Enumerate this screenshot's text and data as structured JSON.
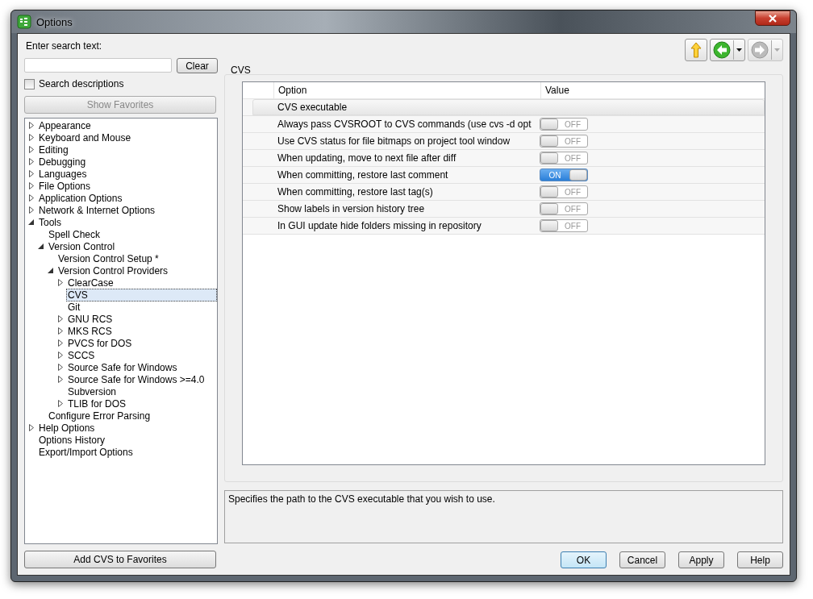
{
  "window": {
    "title": "Options"
  },
  "search": {
    "label": "Enter search text:",
    "clear_button": "Clear",
    "descriptions_checkbox": {
      "label": "Search descriptions",
      "checked": false
    },
    "favorites_button": {
      "label": "Show Favorites",
      "disabled": true
    }
  },
  "tree": {
    "items": [
      {
        "label": "Appearance",
        "expanded": false,
        "selected": false
      },
      {
        "label": "Keyboard and Mouse",
        "expanded": false,
        "selected": false
      },
      {
        "label": "Editing",
        "expanded": false,
        "selected": false
      },
      {
        "label": "Debugging",
        "expanded": false,
        "selected": false
      },
      {
        "label": "Languages",
        "expanded": false,
        "selected": false
      },
      {
        "label": "File Options",
        "expanded": false,
        "selected": false
      },
      {
        "label": "Application Options",
        "expanded": false,
        "selected": false
      },
      {
        "label": "Network & Internet Options",
        "expanded": false,
        "selected": false
      },
      {
        "label": "Tools",
        "expanded": true,
        "selected": false,
        "children": [
          {
            "label": "Spell Check",
            "selected": false
          },
          {
            "label": "Version Control",
            "expanded": true,
            "selected": false,
            "children": [
              {
                "label": "Version Control Setup *",
                "selected": false
              },
              {
                "label": "Version Control Providers",
                "expanded": true,
                "selected": false,
                "children": [
                  {
                    "label": "ClearCase",
                    "expanded": false,
                    "selected": false
                  },
                  {
                    "label": "CVS",
                    "selected": true
                  },
                  {
                    "label": "Git",
                    "selected": false
                  },
                  {
                    "label": "GNU RCS",
                    "expanded": false,
                    "selected": false
                  },
                  {
                    "label": "MKS RCS",
                    "expanded": false,
                    "selected": false
                  },
                  {
                    "label": "PVCS for DOS",
                    "expanded": false,
                    "selected": false
                  },
                  {
                    "label": "SCCS",
                    "expanded": false,
                    "selected": false
                  },
                  {
                    "label": "Source Safe for Windows",
                    "expanded": false,
                    "selected": false
                  },
                  {
                    "label": "Source Safe for Windows >=4.0",
                    "expanded": false,
                    "selected": false
                  },
                  {
                    "label": "Subversion",
                    "selected": false
                  },
                  {
                    "label": "TLIB for DOS",
                    "expanded": false,
                    "selected": false
                  }
                ]
              }
            ]
          },
          {
            "label": "Configure Error Parsing",
            "selected": false
          }
        ]
      },
      {
        "label": "Help Options",
        "expanded": false,
        "selected": false
      },
      {
        "label": "Options History",
        "selected": false
      },
      {
        "label": "Export/Import Options",
        "selected": false
      }
    ]
  },
  "add_favorites_button": "Add CVS to Favorites",
  "toolbar": {
    "up_button": {
      "disabled": false
    },
    "back_button": {
      "disabled": false
    },
    "forward_button": {
      "disabled": true
    }
  },
  "panel": {
    "title": "CVS",
    "table": {
      "columns": [
        "Option",
        "Value"
      ],
      "rows": [
        {
          "kind": "group",
          "label": "CVS executable"
        },
        {
          "kind": "toggle",
          "label": "Always pass CVSROOT to CVS commands (use cvs -d opt",
          "on": false,
          "switch_label": "OFF"
        },
        {
          "kind": "toggle",
          "label": "Use CVS status for file bitmaps on project tool window",
          "on": false,
          "switch_label": "OFF"
        },
        {
          "kind": "toggle",
          "label": "When updating, move to next file after diff",
          "on": false,
          "switch_label": "OFF"
        },
        {
          "kind": "toggle",
          "label": "When committing, restore last comment",
          "on": true,
          "switch_label": "ON"
        },
        {
          "kind": "toggle",
          "label": "When committing, restore last tag(s)",
          "on": false,
          "switch_label": "OFF"
        },
        {
          "kind": "toggle",
          "label": "Show labels in version history tree",
          "on": false,
          "switch_label": "OFF"
        },
        {
          "kind": "toggle",
          "label": "In GUI update hide folders missing in repository",
          "on": false,
          "switch_label": "OFF"
        }
      ]
    },
    "description": "Specifies the path to the CVS executable that you wish to use."
  },
  "buttons": [
    {
      "label": "OK",
      "default": true
    },
    {
      "label": "Cancel",
      "default": false
    },
    {
      "label": "Apply",
      "default": false
    },
    {
      "label": "Help",
      "default": false
    }
  ]
}
